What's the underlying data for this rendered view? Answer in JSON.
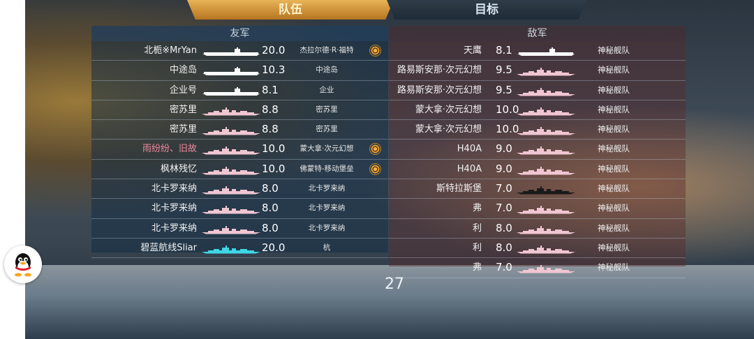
{
  "tabs": {
    "team": "队伍",
    "target": "目标"
  },
  "friendly": {
    "header": "友军",
    "rows": [
      {
        "name": "北栀※MrYan",
        "rating": "20.0",
        "ship": "杰拉尔德·R·福特",
        "silhouette": "carrier",
        "color": "#ffffff",
        "helm": true,
        "highlight": false
      },
      {
        "name": "中途岛",
        "rating": "10.3",
        "ship": "中途岛",
        "silhouette": "carrier",
        "color": "#ffffff",
        "helm": false,
        "highlight": false
      },
      {
        "name": "企业号",
        "rating": "8.1",
        "ship": "企业",
        "silhouette": "carrier",
        "color": "#ffffff",
        "helm": false,
        "highlight": false
      },
      {
        "name": "密苏里",
        "rating": "8.8",
        "ship": "密苏里",
        "silhouette": "battleship",
        "color": "#f0c6d2",
        "helm": false,
        "highlight": false
      },
      {
        "name": "密苏里",
        "rating": "8.8",
        "ship": "密苏里",
        "silhouette": "battleship",
        "color": "#f0c6d2",
        "helm": false,
        "highlight": false
      },
      {
        "name": "雨纷纷、旧故",
        "rating": "10.0",
        "ship": "蒙大拿·次元幻想",
        "silhouette": "battleship",
        "color": "#f0c6d2",
        "helm": true,
        "highlight": true
      },
      {
        "name": "枫林残忆",
        "rating": "10.0",
        "ship": "佛蒙特-移动堡垒",
        "silhouette": "battleship",
        "color": "#f0c6d2",
        "helm": true,
        "highlight": false
      },
      {
        "name": "北卡罗来纳",
        "rating": "8.0",
        "ship": "北卡罗来纳",
        "silhouette": "battleship",
        "color": "#f0c6d2",
        "helm": false,
        "highlight": false
      },
      {
        "name": "北卡罗来纳",
        "rating": "8.0",
        "ship": "北卡罗来纳",
        "silhouette": "battleship",
        "color": "#f0c6d2",
        "helm": false,
        "highlight": false
      },
      {
        "name": "北卡罗来纳",
        "rating": "8.0",
        "ship": "北卡罗来纳",
        "silhouette": "battleship",
        "color": "#f0c6d2",
        "helm": false,
        "highlight": false
      },
      {
        "name": "碧蓝航线Sliar",
        "rating": "20.0",
        "ship": "杭",
        "silhouette": "battleship",
        "color": "#3fd6e6",
        "helm": false,
        "highlight": false
      }
    ]
  },
  "enemy": {
    "header": "敌军",
    "rows": [
      {
        "ship": "天鹰",
        "rating": "8.1",
        "faction": "神秘舰队",
        "silhouette": "carrier",
        "color": "#ffffff"
      },
      {
        "ship": "路易斯安那·次元幻想",
        "rating": "9.5",
        "faction": "神秘舰队",
        "silhouette": "battleship",
        "color": "#f0c6d2"
      },
      {
        "ship": "路易斯安那·次元幻想",
        "rating": "9.5",
        "faction": "神秘舰队",
        "silhouette": "battleship",
        "color": "#f0c6d2"
      },
      {
        "ship": "蒙大拿·次元幻想",
        "rating": "10.0",
        "faction": "神秘舰队",
        "silhouette": "battleship",
        "color": "#f0c6d2"
      },
      {
        "ship": "蒙大拿·次元幻想",
        "rating": "10.0",
        "faction": "神秘舰队",
        "silhouette": "battleship",
        "color": "#f0c6d2"
      },
      {
        "ship": "H40A",
        "rating": "9.0",
        "faction": "神秘舰队",
        "silhouette": "battleship",
        "color": "#f0c6d2"
      },
      {
        "ship": "H40A",
        "rating": "9.0",
        "faction": "神秘舰队",
        "silhouette": "battleship",
        "color": "#f0c6d2"
      },
      {
        "ship": "斯特拉斯堡",
        "rating": "7.0",
        "faction": "神秘舰队",
        "silhouette": "battleship",
        "color": "#1a1a1a"
      },
      {
        "ship": "弗",
        "rating": "7.0",
        "faction": "神秘舰队",
        "silhouette": "battleship",
        "color": "#f0c6d2"
      },
      {
        "ship": "利",
        "rating": "8.0",
        "faction": "神秘舰队",
        "silhouette": "battleship",
        "color": "#f0c6d2"
      },
      {
        "ship": "利",
        "rating": "8.0",
        "faction": "神秘舰队",
        "silhouette": "battleship",
        "color": "#f0c6d2"
      },
      {
        "ship": "弗",
        "rating": "7.0",
        "faction": "神秘舰队",
        "silhouette": "battleship",
        "color": "#f0c6d2"
      }
    ]
  },
  "timer": "27",
  "icons": {
    "helm": "ship-wheel-icon",
    "qq": "qq-penguin-icon"
  }
}
